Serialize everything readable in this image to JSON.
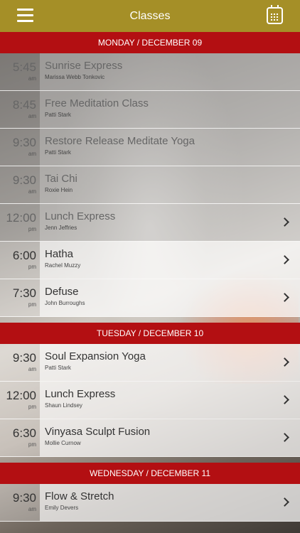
{
  "header": {
    "title": "Classes",
    "menu_icon": "hamburger-menu-icon",
    "calendar_icon": "calendar-icon"
  },
  "colors": {
    "header_bg": "#a58f27",
    "day_header_bg": "#b30f12"
  },
  "days": [
    {
      "label": "MONDAY / DECEMBER 09",
      "classes": [
        {
          "time": "5:45",
          "ampm": "am",
          "name": "Sunrise Express",
          "instructor": "Marissa Webb Tonkovic",
          "past": true,
          "chevron": false
        },
        {
          "time": "8:45",
          "ampm": "am",
          "name": "Free Meditation Class",
          "instructor": "Patti Stark",
          "past": true,
          "chevron": false
        },
        {
          "time": "9:30",
          "ampm": "am",
          "name": "Restore Release Meditate Yoga",
          "instructor": "Patti Stark",
          "past": true,
          "chevron": false
        },
        {
          "time": "9:30",
          "ampm": "am",
          "name": "Tai Chi",
          "instructor": "Roxie Hein",
          "past": true,
          "chevron": false
        },
        {
          "time": "12:00",
          "ampm": "pm",
          "name": " Lunch Express",
          "instructor": "Jenn Jeffries",
          "past": true,
          "chevron": true
        },
        {
          "time": "6:00",
          "ampm": "pm",
          "name": "Hatha",
          "instructor": "Rachel Muzzy",
          "past": false,
          "chevron": true
        },
        {
          "time": "7:30",
          "ampm": "pm",
          "name": "Defuse",
          "instructor": "John Burroughs",
          "past": false,
          "chevron": true
        }
      ]
    },
    {
      "label": "TUESDAY / DECEMBER 10",
      "classes": [
        {
          "time": "9:30",
          "ampm": "am",
          "name": "Soul Expansion Yoga",
          "instructor": "Patti Stark",
          "past": false,
          "chevron": true
        },
        {
          "time": "12:00",
          "ampm": "pm",
          "name": " Lunch Express",
          "instructor": "Shaun Lindsey",
          "past": false,
          "chevron": true
        },
        {
          "time": "6:30",
          "ampm": "pm",
          "name": "Vinyasa Sculpt Fusion",
          "instructor": "Mollie Curnow",
          "past": false,
          "chevron": true
        }
      ]
    },
    {
      "label": "WEDNESDAY / DECEMBER 11",
      "classes": [
        {
          "time": "9:30",
          "ampm": "am",
          "name": "Flow & Stretch",
          "instructor": "Emily Devers",
          "past": false,
          "chevron": true
        }
      ]
    }
  ]
}
